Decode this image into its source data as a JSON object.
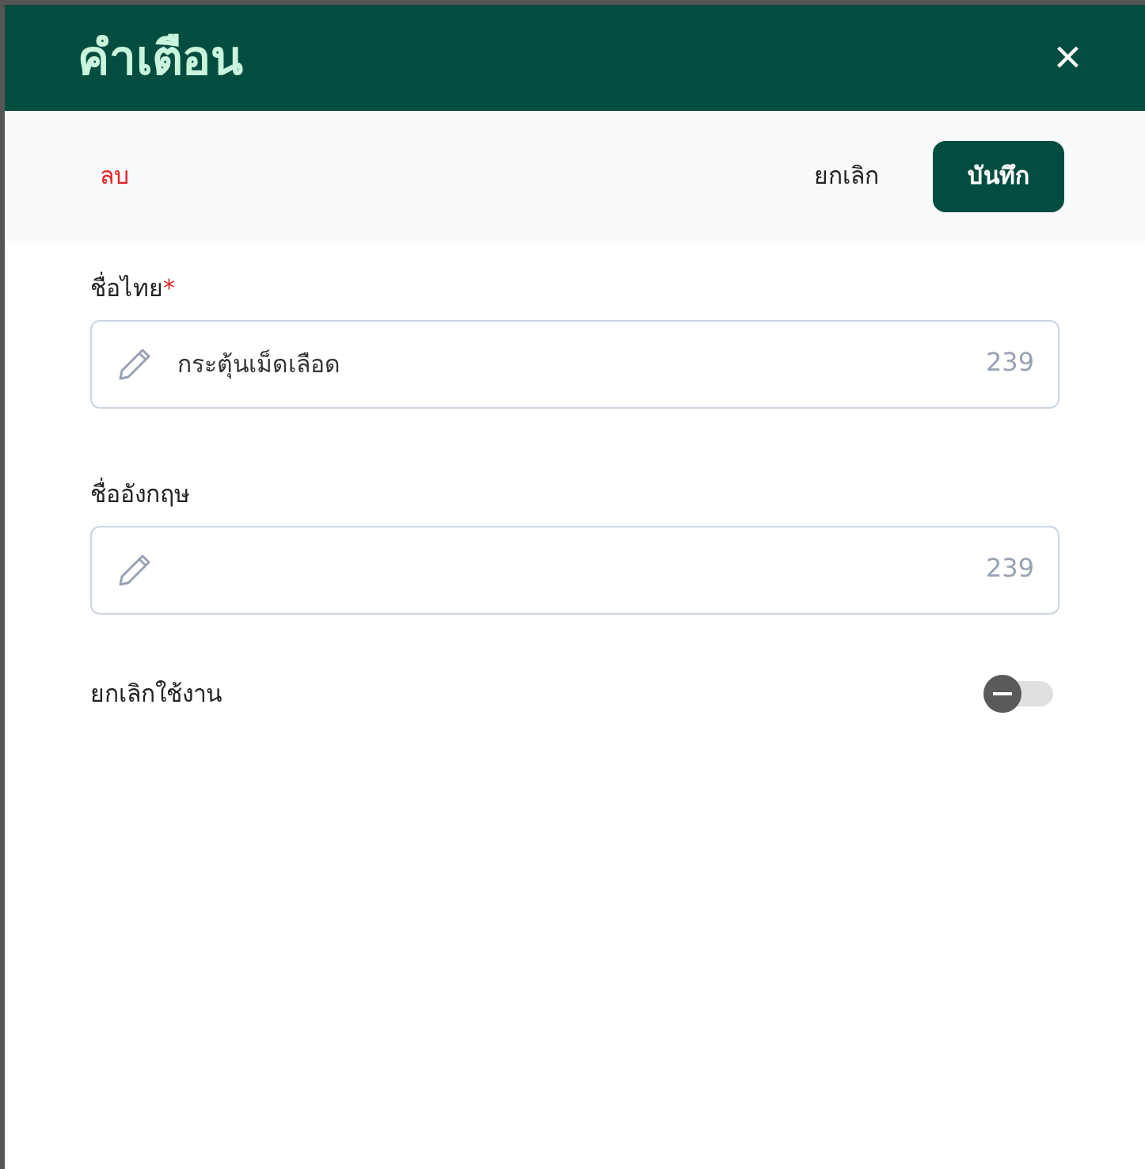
{
  "window": {
    "title": "คำเตือน",
    "close": "×"
  },
  "toolbar": {
    "delete": "ลบ",
    "cancel": "ยกเลิก",
    "save": "บันทึก"
  },
  "fields": [
    {
      "label": "ชื่อไทย",
      "required_mark": "*",
      "value": "กระตุ้นเม็ดเลือด",
      "counter": "239"
    },
    {
      "label": "ชื่ออังกฤษ",
      "counter": "239"
    }
  ],
  "toggle": {
    "label": "ยกเลิกใช้งาน",
    "on": false
  }
}
